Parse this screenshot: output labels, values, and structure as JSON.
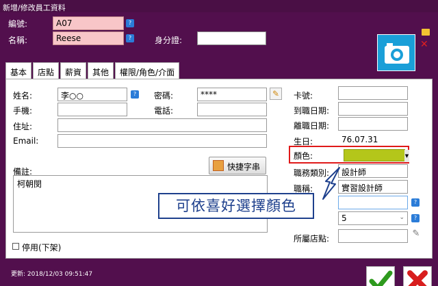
{
  "window": {
    "title": "新增/修改員工資料"
  },
  "header": {
    "id_label": "編號:",
    "id_value": "A07",
    "name_label": "名稱:",
    "name_value": "Reese",
    "idcard_label": "身分證:",
    "idcard_value": ""
  },
  "tabs": [
    "基本",
    "店點",
    "薪資",
    "其他",
    "權限/角色/介面"
  ],
  "basic": {
    "fullname_label": "姓名:",
    "fullname_value": "李○○",
    "password_label": "密碼:",
    "password_value": "****",
    "mobile_label": "手機:",
    "mobile_value": "",
    "phone_label": "電話:",
    "phone_value": "",
    "address_label": "住址:",
    "address_value": "",
    "email_label": "Email:",
    "email_value": "",
    "notes_label": "備註:",
    "notes_value": "柯朝閔",
    "quick_button": "快捷字串",
    "card_label": "卡號:",
    "card_value": "",
    "hire_label": "到職日期:",
    "hire_value": "",
    "leave_label": "離職日期:",
    "leave_value": "",
    "birthday_label": "生日:",
    "birthday_value": "76.07.31",
    "color_label": "顏色:",
    "jobtype_label": "職務類別:",
    "jobtype_value": "設計師",
    "jobtitle_label": "職稱:",
    "jobtitle_value": "實習設計師",
    "select_value": "5",
    "store_label": "所屬店點:",
    "store_value": "",
    "disable_label": "停用(下架)"
  },
  "callout": "可依喜好選擇顏色",
  "footer": {
    "updated": "更新:     2018/12/03 09:51:47"
  },
  "colors": {
    "window": "#520f4d",
    "selected_color": "#b4c61a",
    "highlight": "#e01818",
    "callout": "#1d3f8c"
  }
}
